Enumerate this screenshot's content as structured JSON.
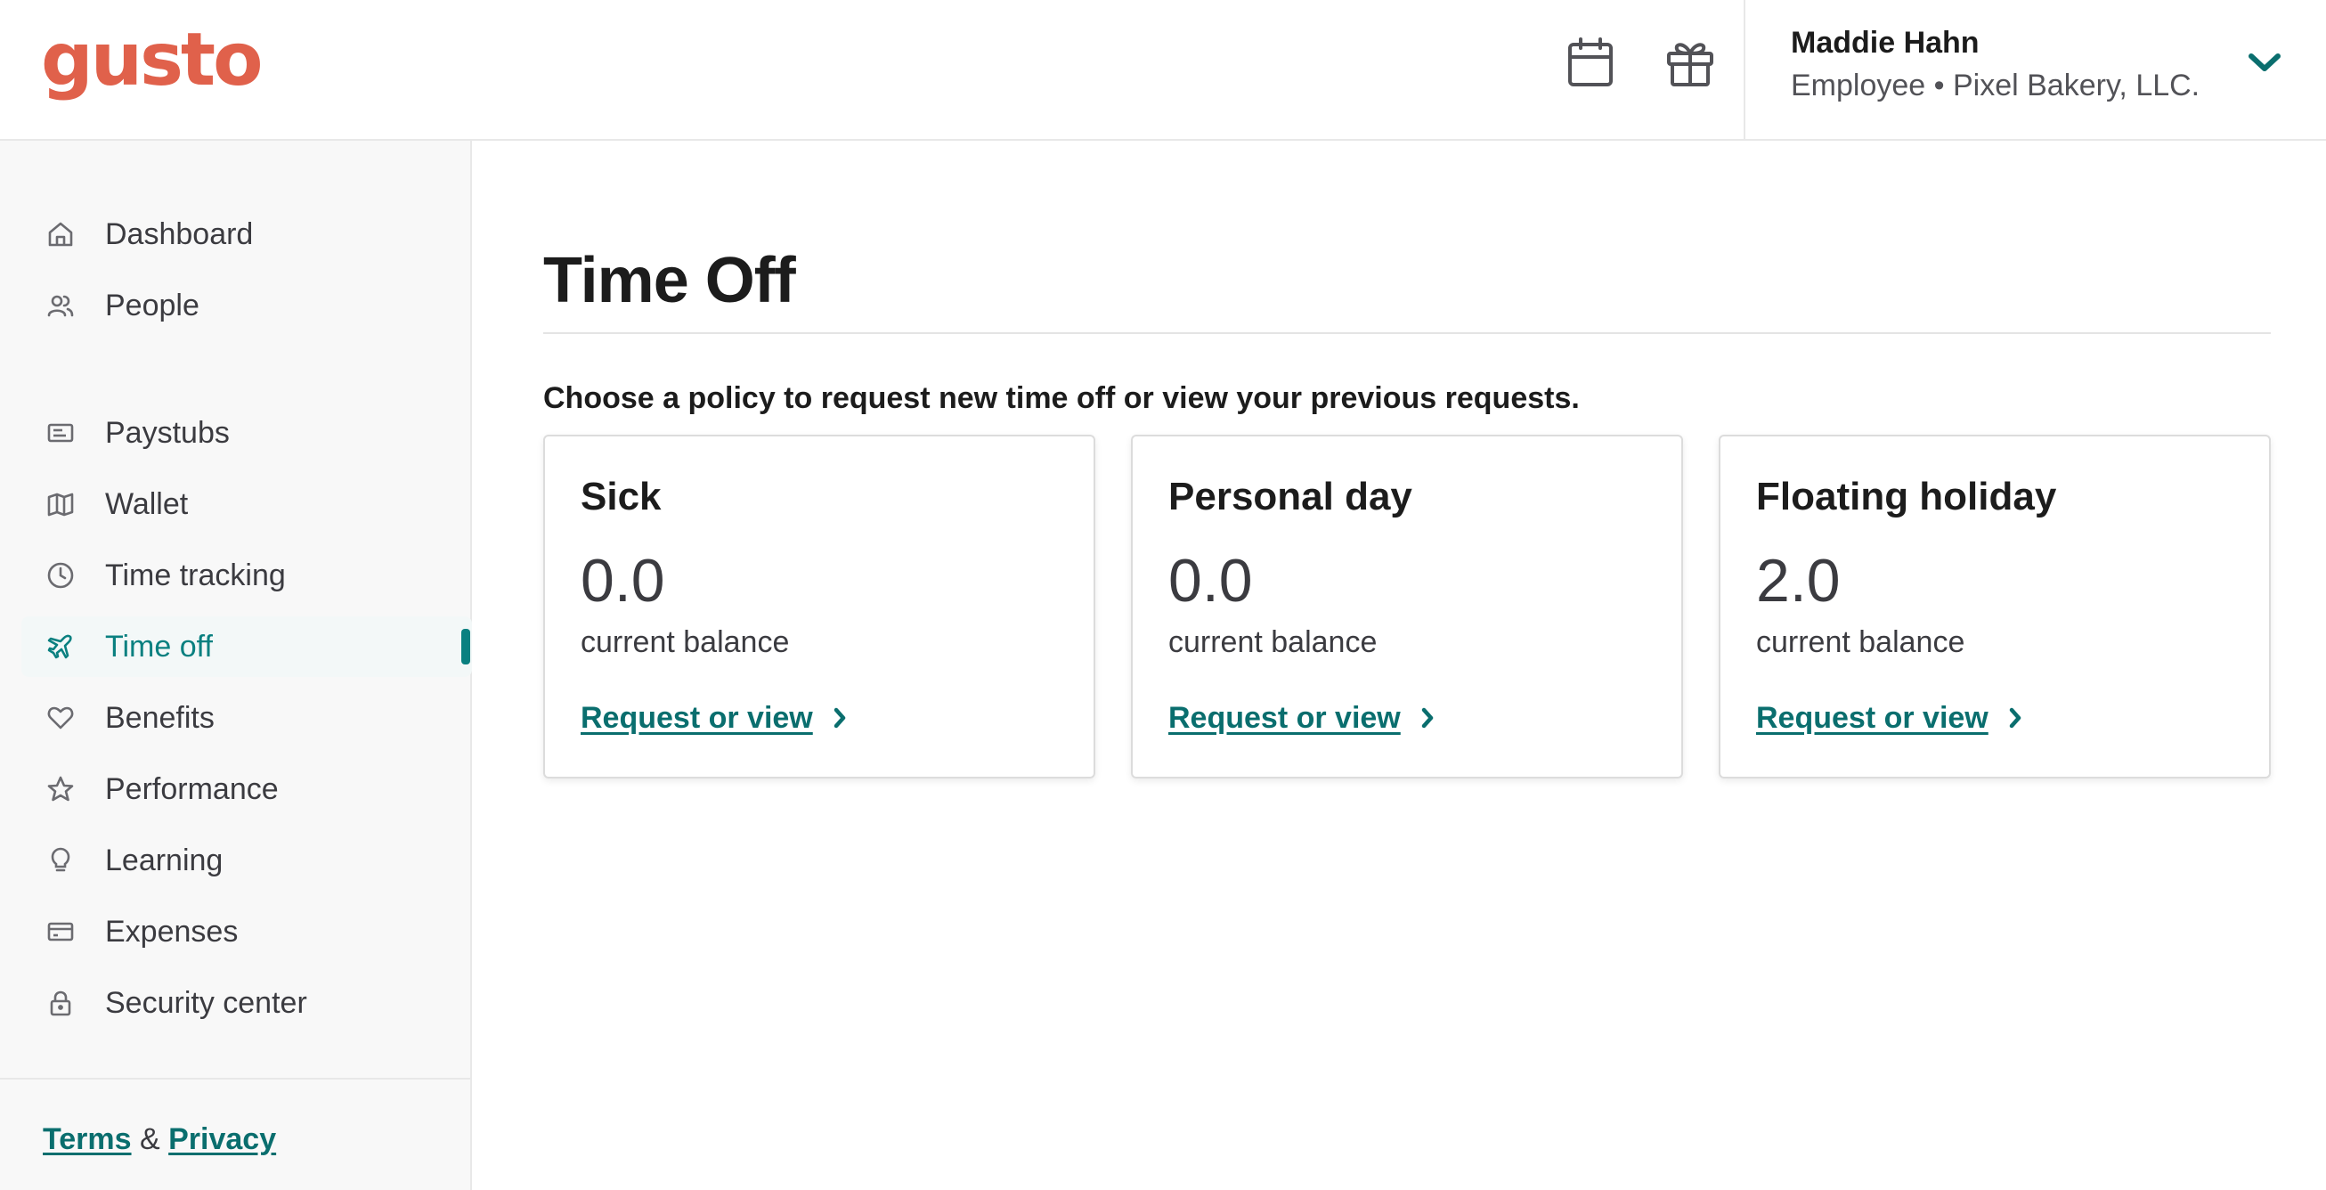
{
  "header": {
    "logo_text": "gusto",
    "brand_color": "#e0614b",
    "icons": [
      "calendar-icon",
      "gift-icon"
    ],
    "user": {
      "name": "Maddie Hahn",
      "role_line": "Employee • Pixel Bakery, LLC."
    }
  },
  "sidebar": {
    "items": [
      {
        "label": "Dashboard",
        "icon": "home-icon"
      },
      {
        "label": "People",
        "icon": "people-icon"
      },
      {
        "label": "Paystubs",
        "icon": "paystub-icon"
      },
      {
        "label": "Wallet",
        "icon": "wallet-icon"
      },
      {
        "label": "Time tracking",
        "icon": "clock-icon"
      },
      {
        "label": "Time off",
        "icon": "airplane-icon",
        "active": true
      },
      {
        "label": "Benefits",
        "icon": "heart-icon"
      },
      {
        "label": "Performance",
        "icon": "star-icon"
      },
      {
        "label": "Learning",
        "icon": "lightbulb-icon"
      },
      {
        "label": "Expenses",
        "icon": "credit-card-icon"
      },
      {
        "label": "Security center",
        "icon": "lock-icon"
      }
    ],
    "footer": {
      "terms": "Terms",
      "amp": "&",
      "privacy": "Privacy"
    },
    "accent_color": "#0a8080"
  },
  "main": {
    "title": "Time Off",
    "subtitle": "Choose a policy to request new time off or view your previous requests.",
    "policies": [
      {
        "name": "Sick",
        "balance": "0.0",
        "caption": "current balance",
        "link": "Request or view"
      },
      {
        "name": "Personal day",
        "balance": "0.0",
        "caption": "current balance",
        "link": "Request or view"
      },
      {
        "name": "Floating holiday",
        "balance": "2.0",
        "caption": "current balance",
        "link": "Request or view"
      }
    ]
  }
}
